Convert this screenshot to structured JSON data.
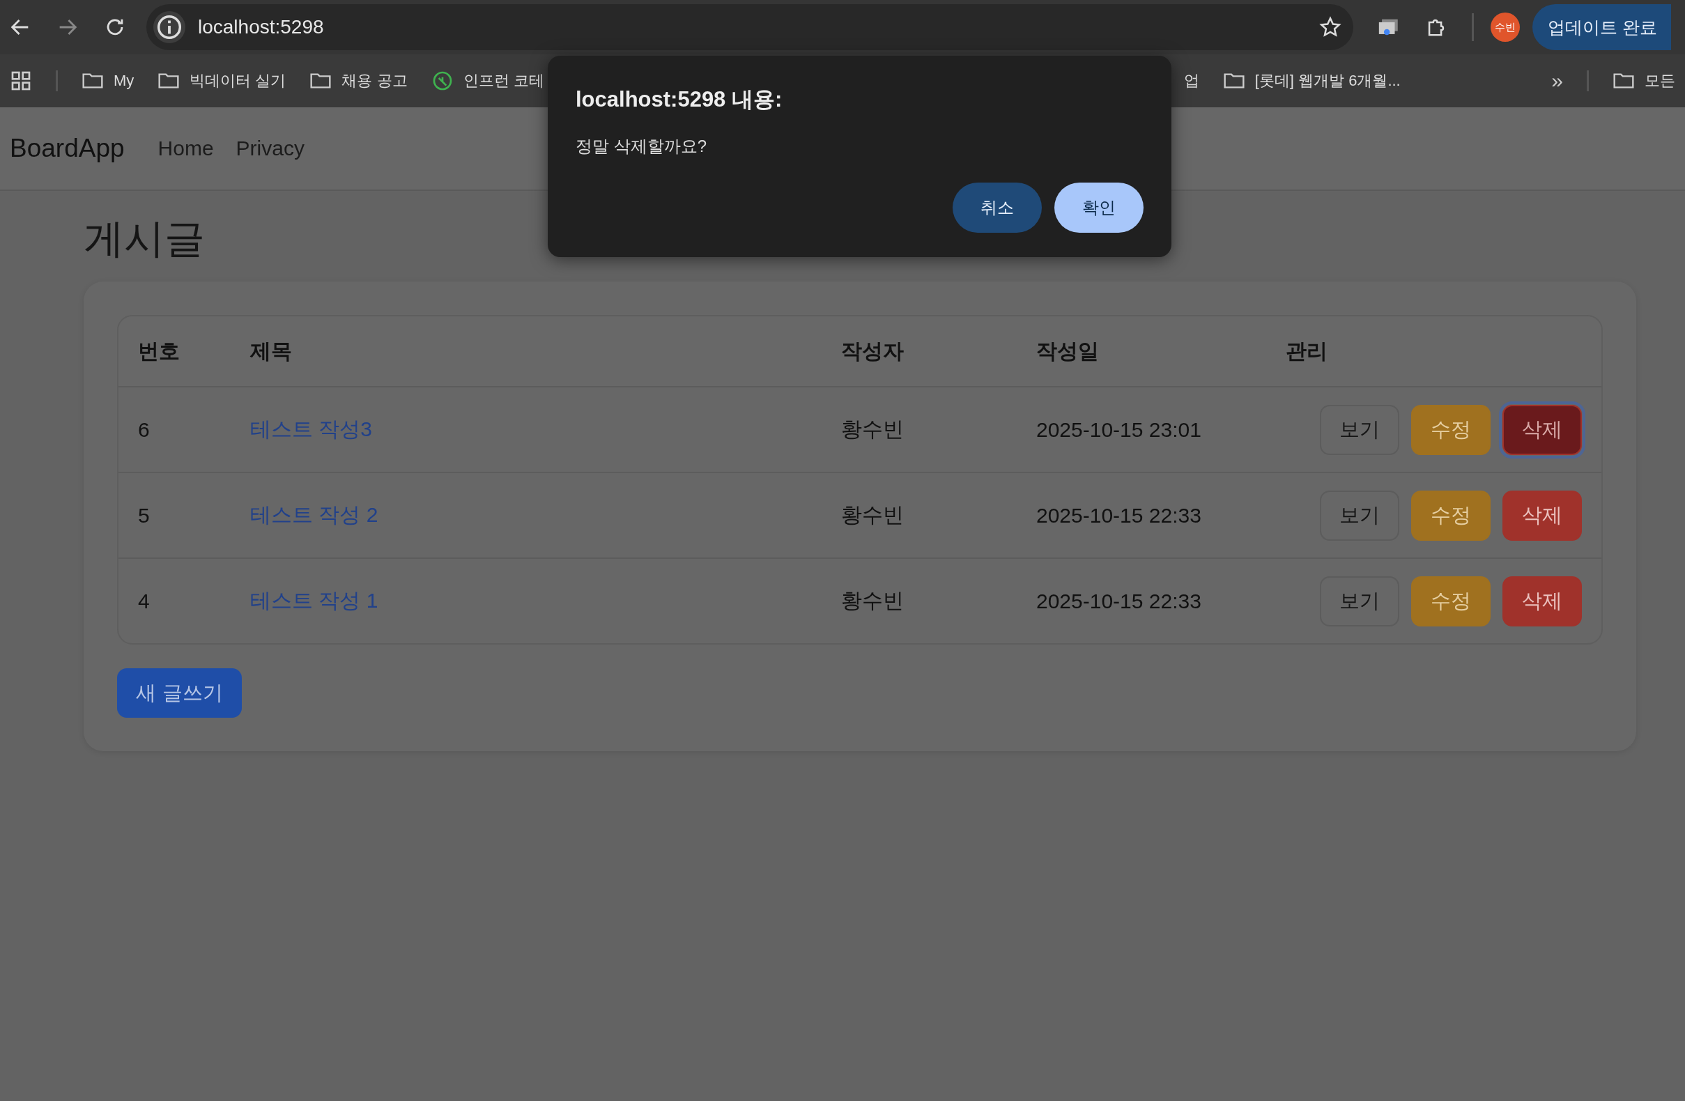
{
  "browser": {
    "address": "localhost:5298",
    "profile": "수빈",
    "update_button": "업데이트 완료",
    "bookmarks_left": [
      {
        "kind": "apps"
      },
      {
        "kind": "folder",
        "label": "My"
      },
      {
        "kind": "folder",
        "label": "빅데이터 실기"
      },
      {
        "kind": "folder",
        "label": "채용 공고"
      },
      {
        "kind": "site",
        "label": "인프런 코테"
      }
    ],
    "bookmarks_right": [
      {
        "kind": "text",
        "label": "업"
      },
      {
        "kind": "folder",
        "label": "[롯데] 웹개발 6개월..."
      }
    ],
    "overflow": "»",
    "all_bookmarks": "모든"
  },
  "navbar": {
    "brand": "BoardApp",
    "links": [
      "Home",
      "Privacy"
    ]
  },
  "page": {
    "title": "게시글",
    "table": {
      "columns": [
        "번호",
        "제목",
        "작성자",
        "작성일",
        "관리"
      ],
      "rows": [
        {
          "no": "6",
          "title": "테스트 작성3",
          "author": "황수빈",
          "date": "2025-10-15 23:01",
          "actions": [
            {
              "kind": "view",
              "label": "보기",
              "focused": false
            },
            {
              "kind": "edit",
              "label": "수정",
              "focused": false
            },
            {
              "kind": "delete",
              "label": "삭제",
              "focused": true
            }
          ]
        },
        {
          "no": "5",
          "title": "테스트 작성 2",
          "author": "황수빈",
          "date": "2025-10-15 22:33",
          "actions": [
            {
              "kind": "view",
              "label": "보기",
              "focused": false
            },
            {
              "kind": "edit",
              "label": "수정",
              "focused": false
            },
            {
              "kind": "delete",
              "label": "삭제",
              "focused": false
            }
          ]
        },
        {
          "no": "4",
          "title": "테스트 작성 1",
          "author": "황수빈",
          "date": "2025-10-15 22:33",
          "actions": [
            {
              "kind": "view",
              "label": "보기",
              "focused": false
            },
            {
              "kind": "edit",
              "label": "수정",
              "focused": false
            },
            {
              "kind": "delete",
              "label": "삭제",
              "focused": false
            }
          ]
        }
      ]
    },
    "new_button": "새 글쓰기"
  },
  "dialog": {
    "title": "localhost:5298 내용:",
    "message": "정말 삭제할까요?",
    "buttons": [
      {
        "kind": "cancel",
        "label": "취소"
      },
      {
        "kind": "ok",
        "label": "확인"
      }
    ]
  }
}
